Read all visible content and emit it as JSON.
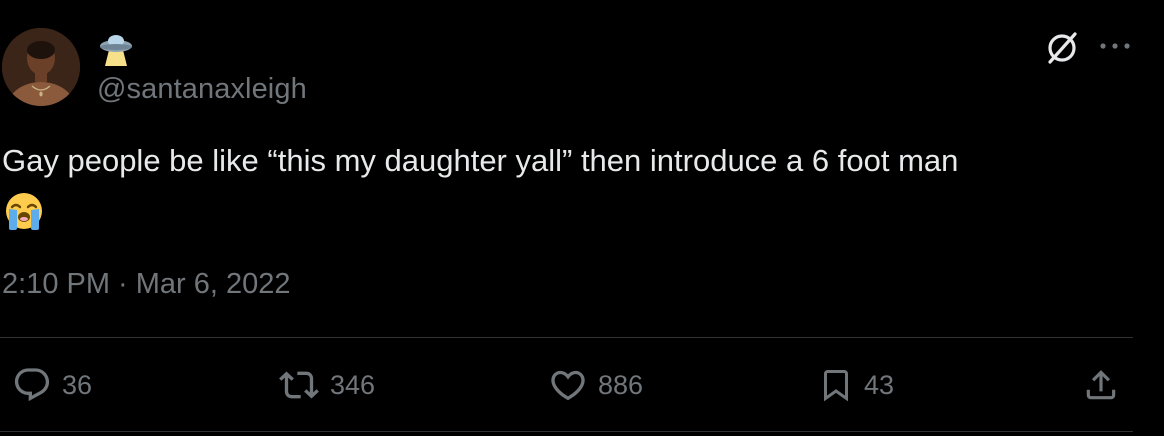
{
  "tweet": {
    "author_handle": "@santanaxleigh",
    "author_emoji": "flying-saucer-emoji",
    "text": "Gay people be like “this my daughter yall” then introduce a 6 foot man",
    "text_emoji": "loudly-crying-face-emoji",
    "timestamp": "2:10 PM · Mar 6, 2022"
  },
  "header_actions": {
    "grok_icon": "grok-icon",
    "more_icon": "more-horizontal-icon"
  },
  "actions": {
    "reply_count": "36",
    "retweet_count": "346",
    "like_count": "886",
    "bookmark_count": "43"
  },
  "colors": {
    "background": "#000000",
    "primary_text": "#e7e9ea",
    "secondary_text": "#71767b",
    "divider": "#2f3336"
  }
}
